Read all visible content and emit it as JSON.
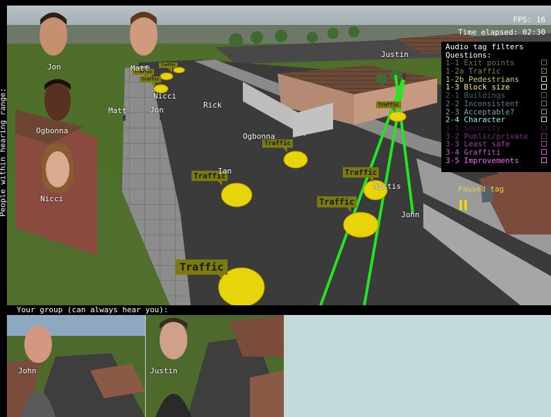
{
  "hud": {
    "fps": "FPS: 16",
    "time_elapsed": "Time elapsed: 02:30"
  },
  "side_label": "People within hearing range:",
  "nearby_people": [
    {
      "name": "Jon"
    },
    {
      "name": "Matt"
    },
    {
      "name": "Ogbonna"
    },
    {
      "name": "Nicci"
    }
  ],
  "world_labels": {
    "justin": "Justin",
    "nicci": "Nicci",
    "jon": "Jon",
    "matt": "Matt",
    "rick": "Rick",
    "ogbonna": "Ogbonna",
    "ian": "Ian",
    "aistis": "Aistis",
    "john": "John"
  },
  "tags": {
    "label": "Traffic"
  },
  "filters": {
    "title": "Audio tag filters",
    "subtitle": "Questions:",
    "items": [
      {
        "code": "1-1",
        "label": "Exit points",
        "color": "#6e7a2a",
        "checked": false
      },
      {
        "code": "1-2a",
        "label": "Traffic",
        "color": "#7e8a2a",
        "checked": true
      },
      {
        "code": "1-2b",
        "label": "Pedestrians",
        "color": "#d2d250",
        "checked": false
      },
      {
        "code": "1-3",
        "label": "Block size",
        "color": "#ffff50",
        "checked": false
      },
      {
        "code": "2-1",
        "label": "Buildings",
        "color": "#2e6a6a",
        "checked": false
      },
      {
        "code": "2-2",
        "label": "Inconsistent",
        "color": "#3c8a8a",
        "checked": false
      },
      {
        "code": "2-3",
        "label": "Acceptable?",
        "color": "#5ab0b0",
        "checked": false
      },
      {
        "code": "2-4",
        "label": "Character",
        "color": "#8af0f0",
        "checked": false
      },
      {
        "code": "3-1",
        "label": "Security",
        "color": "#4a104a",
        "checked": false
      },
      {
        "code": "3-2",
        "label": "Public/private",
        "color": "#7a2a7a",
        "checked": false
      },
      {
        "code": "3-3",
        "label": "Least safe",
        "color": "#a43aa4",
        "checked": false
      },
      {
        "code": "3-4",
        "label": "Graffiti",
        "color": "#d44ad4",
        "checked": false
      },
      {
        "code": "3-5",
        "label": "Improvements",
        "color": "#ff5aff",
        "checked": false
      }
    ]
  },
  "paused_tag": "Paused tag",
  "group": {
    "header": "Your group (can always hear you):",
    "members": [
      {
        "name": "John"
      },
      {
        "name": "Justin"
      }
    ]
  },
  "colors": {
    "tag_bg": "#7a7a10",
    "tag_blob": "#e8d40a",
    "path_green": "#22e622",
    "grass": "#4f6e2a",
    "road": "#3d3d3d",
    "panel_bg": "#c3d8d9"
  }
}
